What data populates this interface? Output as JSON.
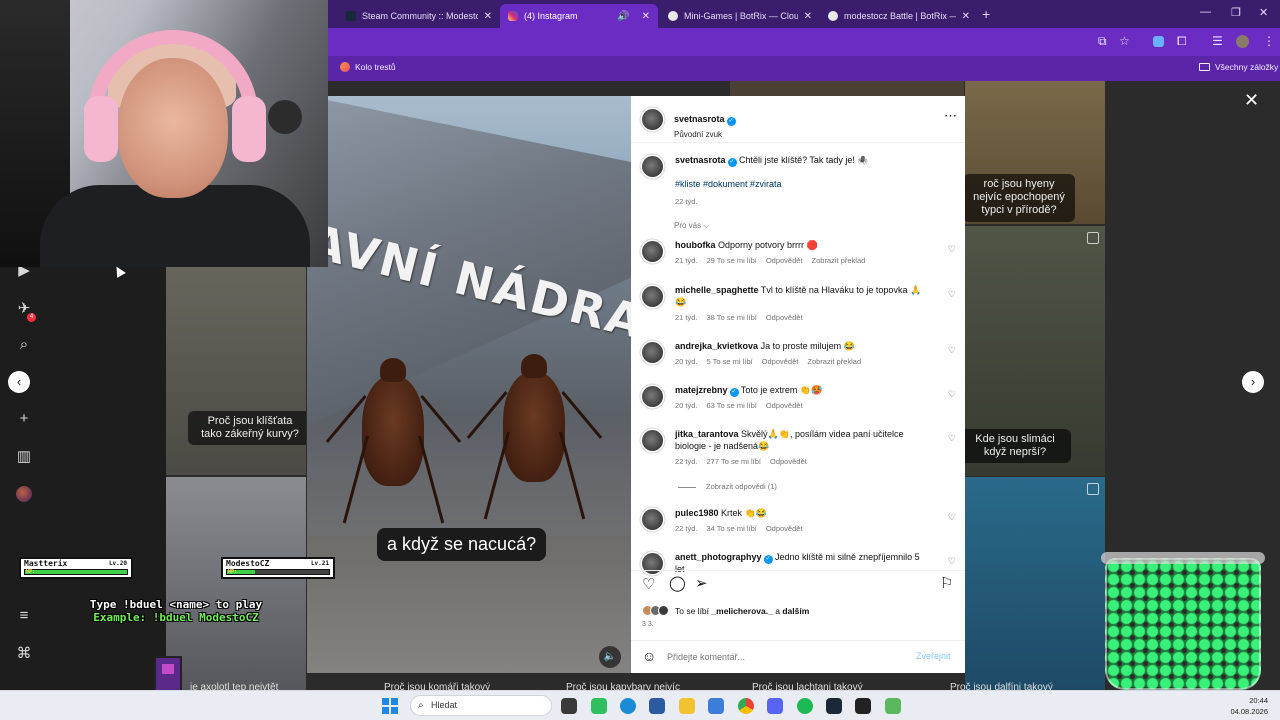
{
  "browser": {
    "tabs": [
      {
        "label": "Steam Community :: ModestoCZ",
        "active": false
      },
      {
        "label": "(4) Instagram",
        "active": true
      },
      {
        "label": "Mini-Games | BotRix — Cloud S",
        "active": false
      },
      {
        "label": "modestocz Battle | BotRix — Cl",
        "active": false
      }
    ],
    "bookmark": "Kolo trestů",
    "all_bookmarks": "Všechny záložky"
  },
  "post": {
    "author": "svetnasrota",
    "audio": "Původní zvuk",
    "caption": "Chtěli jste klíště? Tak tady je! 🕷️",
    "hashtags": "#kliste #dokument #zvirata",
    "caption_age": "22 týd.",
    "sort_label": "Pro vás ⌵",
    "subtitle": "a když se nacucá?",
    "station_sign": "AVNÍ NÁDRAŽÍ"
  },
  "comments": [
    {
      "user": "houbofka",
      "verified": false,
      "text": "Odporny potvory brrrr 🛑",
      "age": "21 týd.",
      "likes": "29 To se mi líbí",
      "reply": "Odpovědět",
      "translate": "Zobrazit překlad"
    },
    {
      "user": "michelle_spaghette",
      "verified": false,
      "text": "Tvl to klíště na Hlaváku to je topovka 🙏 😂",
      "age": "21 týd.",
      "likes": "38 To se mi líbí",
      "reply": "Odpovědět",
      "translate": ""
    },
    {
      "user": "andrejka_kvietkova",
      "verified": false,
      "text": "Ja to proste milujem 😂",
      "age": "20 týd.",
      "likes": "5 To se mi líbí",
      "reply": "Odpovědět",
      "translate": "Zobrazit překlad"
    },
    {
      "user": "matejzrebny",
      "verified": true,
      "text": "Toto je extrem 👏🥵",
      "age": "20 týd.",
      "likes": "63 To se mi líbí",
      "reply": "Odpovědět",
      "translate": ""
    },
    {
      "user": "jitka_tarantova",
      "verified": false,
      "text": "Skvělý🙏👏, posílám videa paní učitelce biologie - je nadšená😂",
      "age": "22 týd.",
      "likes": "277 To se mi líbí",
      "reply": "Odpovědět",
      "translate": ""
    },
    {
      "user": "pulec1980",
      "verified": false,
      "text": "Krtek 👏😂",
      "age": "22 týd.",
      "likes": "34 To se mi líbí",
      "reply": "Odpovědět",
      "translate": ""
    },
    {
      "user": "anett_photographyy",
      "verified": true,
      "text": "Jedno klíště mi silně znepříjemnilo 5 let",
      "age": "",
      "likes": "",
      "reply": "",
      "translate": ""
    }
  ],
  "view_replies": "Zobrazit odpovědi (1)",
  "likes_line": {
    "prefix": "To se líbí",
    "user": "_melicherova._",
    "mid": "a",
    "rest": "dalším"
  },
  "post_age": "3 3.",
  "comment_box": {
    "placeholder": "Přidejte komentář...",
    "publish": "Zveřejnit"
  },
  "grid_captions": {
    "hyena": "roč jsou hyeny nejvíc epochopený typci v přírodě?",
    "ticks": "Proč jsou klíšťata tako zákeřný kurvy?",
    "snails": "Kde jsou slimáci když neprší?",
    "bottom": [
      "je axolotl tep nejvtět",
      "Proč jsou komáři takový",
      "Proč jsou kapybary nejvíc",
      "Proč jsou lachtani takový",
      "Proč jsou dalfíni takový"
    ]
  },
  "stream": {
    "duel_left": {
      "name": "Mastterix",
      "level": "Lv.20",
      "hp": 1.0
    },
    "duel_right": {
      "name": "ModestoCZ",
      "level": "Lv.21",
      "hp": 0.27
    },
    "hp_label": "HP:",
    "help_line1": "Type !bduel <name> to play",
    "help_line2": "Example: !bduel ModestoCZ"
  },
  "taskbar": {
    "search": "Hledat",
    "time": "20:44",
    "date": "04.08.2026"
  },
  "colors": {
    "chrome": "#6a2cc2",
    "link": "#00376b",
    "publish": "#0095f6",
    "verified": "#0095f6"
  }
}
